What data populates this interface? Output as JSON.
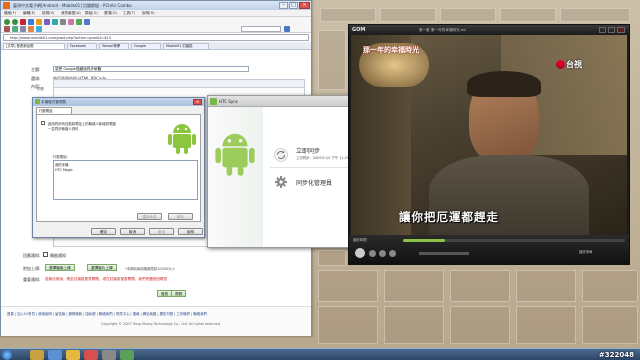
{
  "browser": {
    "title": "臺灣中文電子網[Android - Mobile01] 討論群組 - PChAir Combo",
    "menu": [
      "檔案(F)",
      "編輯(E)",
      "檢視(V)",
      "我的最愛(A)",
      "群組(G)",
      "選項(O)",
      "工具(T)",
      "說明(H)"
    ],
    "address": "http://www.mobile01.com/post.php?action=post&f=423",
    "tabs": [
      "[文章] 發表新話題",
      "Facebook",
      "Yahoo!奇摩",
      "Google",
      "Mobile01 討論區"
    ],
    "form": {
      "title_label": "主題:",
      "title_value": "感恩 Google隱藏版同步軟體",
      "options_label": "選項:",
      "options_value": "啟用表情符號  HTML  BBCode",
      "content_label": "內容:",
      "font_label": "字體",
      "attach_label": "附加上傳:",
      "upload_btn_1": "選擇檔案上傳",
      "upload_btn_2": "選擇圖片上傳",
      "upload_note": "*本網站每個檔案限制1000K大小",
      "notice_label": "重要通知:",
      "notice_text": "若無法使用，請至討論區發表問題，或在討論區發表問題，我們會盡快回覆您",
      "submit": "發表",
      "preview": "預覽",
      "auto_label": "回應通知:",
      "auto_value": "開啟通知",
      "footer_links": "首頁 | 加入01會員 | 使用說明 | 留言版 | 服務條款 | 隱私權 | 聯絡我們 | 會員中心 | 搜尋 | 網站地圖 | 廣告刊登 | 工作機會 | 聯絡我們",
      "copyright": "Copyright © 2007 Yong Sheng Technology Co., Ltd. All rights reserved."
    }
  },
  "dialog1": {
    "title": "手機程式管理員",
    "tab": "行動電話",
    "checkbox_label": "啟用同步時自動將電話上的聯絡人新增到電腦",
    "desc2": "一並同步聯絡人資料",
    "list_label": "行動電話：",
    "list_items": [
      "我的手機",
      "HTC Magic"
    ],
    "btn_rename": "重新命名",
    "btn_remove": "移除",
    "btn_ok": "確定",
    "btn_cancel": "取消",
    "btn_apply": "套用",
    "btn_help": "說明"
  },
  "htc": {
    "title": "HTC Sync",
    "sync_title": "立即同步",
    "sync_sub": "上次同步：2009/11/4 下午 11:25:14",
    "manager_title": "同步化管理員"
  },
  "gom": {
    "logo": "GOM",
    "title": "第一集 第一年的幸福時光.avi",
    "video_title": "那一年的幸福時光",
    "channel": "台視",
    "subtitle": "讓你把厄運都趕走",
    "status_left": "播放時間",
    "status_right": "播放清單"
  },
  "taskbar": {
    "watermark": "#322048"
  }
}
